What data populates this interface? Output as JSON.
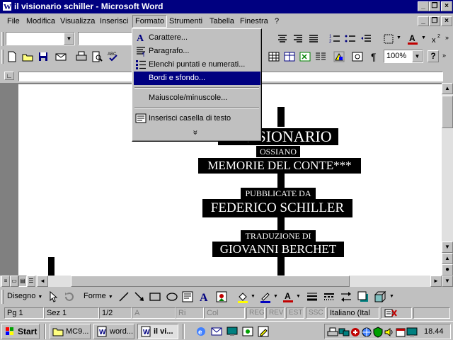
{
  "window": {
    "title": "il visionario schiller - Microsoft Word",
    "controls": [
      "_",
      "❐",
      "×"
    ],
    "doc_controls": [
      "_",
      "❐",
      "×"
    ]
  },
  "menubar": {
    "items": [
      "File",
      "Modifica",
      "Visualizza",
      "Inserisci",
      "Formato",
      "Strumenti",
      "Tabella",
      "Finestra",
      "?"
    ],
    "active": "Formato"
  },
  "formato_menu": {
    "items": [
      {
        "label": "Carattere...",
        "icon": "font-a-icon"
      },
      {
        "label": "Paragrafo...",
        "icon": "paragraph-icon"
      },
      {
        "label": "Elenchi puntati e numerati...",
        "icon": "bullets-icon"
      },
      {
        "label": "Bordi e sfondo...",
        "icon": "",
        "selected": true
      },
      {
        "label": "Maiuscole/minuscole...",
        "icon": ""
      },
      {
        "label": "Inserisci casella di testo",
        "icon": "textbox-icon"
      }
    ],
    "expand_glyph": "»"
  },
  "toolbar": {
    "zoom": "100%",
    "pilcrow": "¶",
    "help": "?"
  },
  "document": {
    "lines": [
      "IL VISIONARIO",
      "OSSIANO",
      "MEMORIE DEL CONTE***",
      "PUBBLICATE DA",
      "FEDERICO SCHILLER",
      "TRADUZIONE DI",
      "GIOVANNI BERCHET"
    ],
    "visible_title_fragment": "IL V  SIONARIO"
  },
  "drawing_toolbar": {
    "draw_label": "Disegno",
    "shapes_label": "Forme"
  },
  "statusbar": {
    "page": "Pg 1",
    "section": "Sez 1",
    "pages": "1/2",
    "at": "A",
    "line": "Ri",
    "col": "Col",
    "modes": [
      "REG",
      "REV",
      "EST",
      "SSC"
    ],
    "language": "Italiano (Ital"
  },
  "taskbar": {
    "start": "Start",
    "tasks": [
      "MC9...",
      "word...",
      "il vi..."
    ],
    "active_task": "il vi...",
    "clock": "18.44"
  }
}
